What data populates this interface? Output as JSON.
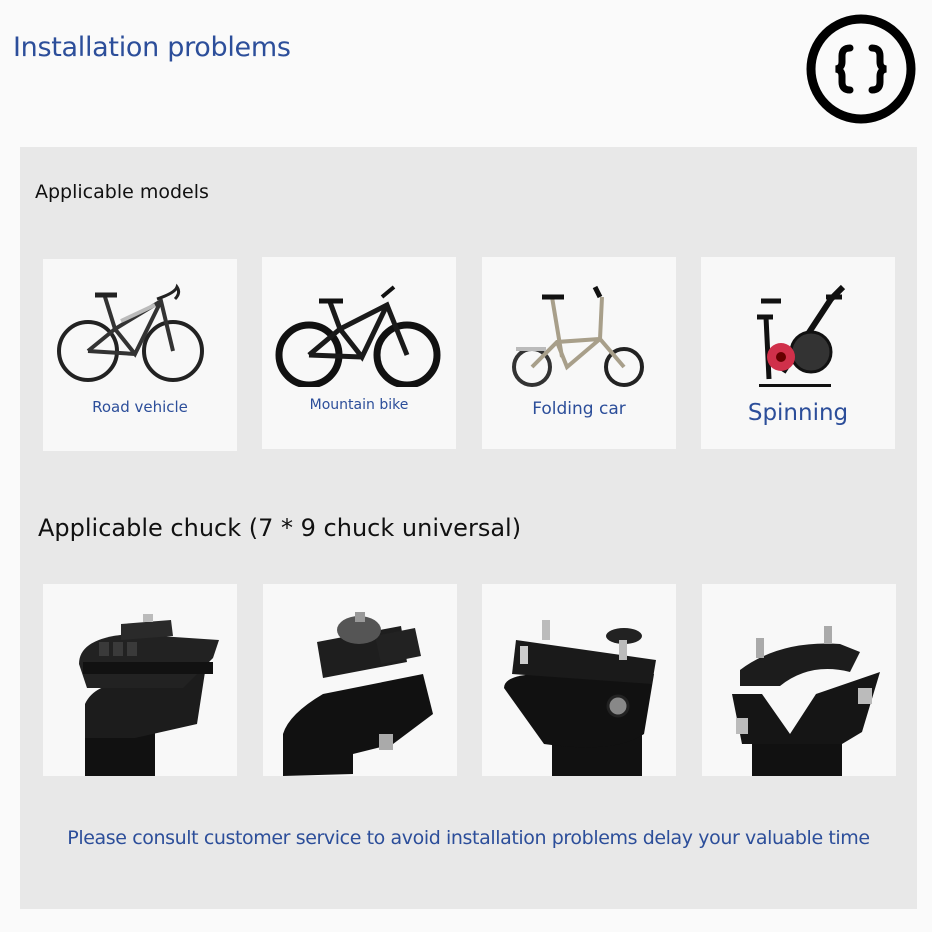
{
  "header": {
    "title": "Installation problems",
    "logo_icon": "curly-braces-circle-icon"
  },
  "models": {
    "title": "Applicable models",
    "items": [
      {
        "label": "Road vehicle",
        "icon": "road-bike-image"
      },
      {
        "label": "Mountain bike",
        "icon": "mountain-bike-image"
      },
      {
        "label": "Folding car",
        "icon": "folding-bike-image"
      },
      {
        "label": "Spinning",
        "icon": "spin-bike-image"
      }
    ]
  },
  "chuck": {
    "title": "Applicable chuck (7 * 9 chuck universal)",
    "items": [
      {
        "icon": "seatpost-clamp-image-1"
      },
      {
        "icon": "seatpost-clamp-image-2"
      },
      {
        "icon": "seatpost-clamp-image-3"
      },
      {
        "icon": "seatpost-clamp-image-4"
      }
    ]
  },
  "notice": "Please consult customer service to avoid installation problems delay your valuable time",
  "colors": {
    "accent_blue": "#2c4e9a",
    "panel_bg": "#e8e8e8",
    "card_bg": "#f8f8f8",
    "spin_red": "#d0304a"
  }
}
